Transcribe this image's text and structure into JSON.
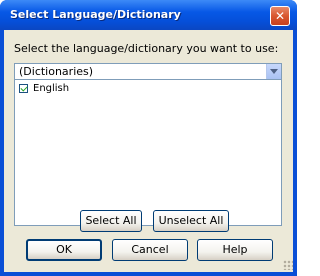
{
  "window": {
    "title": "Select Language/Dictionary"
  },
  "dialog": {
    "instruction": "Select the language/dictionary you want to use:",
    "dropdown": {
      "selected": "(Dictionaries)"
    },
    "list": {
      "items": [
        {
          "label": "English",
          "checked": true
        }
      ]
    },
    "buttons": {
      "select_all": "Select All",
      "unselect_all": "Unselect All",
      "ok": "OK",
      "cancel": "Cancel",
      "help": "Help"
    }
  },
  "colors": {
    "titlebar": "#0758e6",
    "dialog_bg": "#ece9d8",
    "close_button": "#d9572f",
    "field_border": "#7f9db9"
  },
  "icons": {
    "close": "close-icon",
    "dropdown": "chevron-down-icon",
    "checkbox": "checkbox-icon"
  }
}
